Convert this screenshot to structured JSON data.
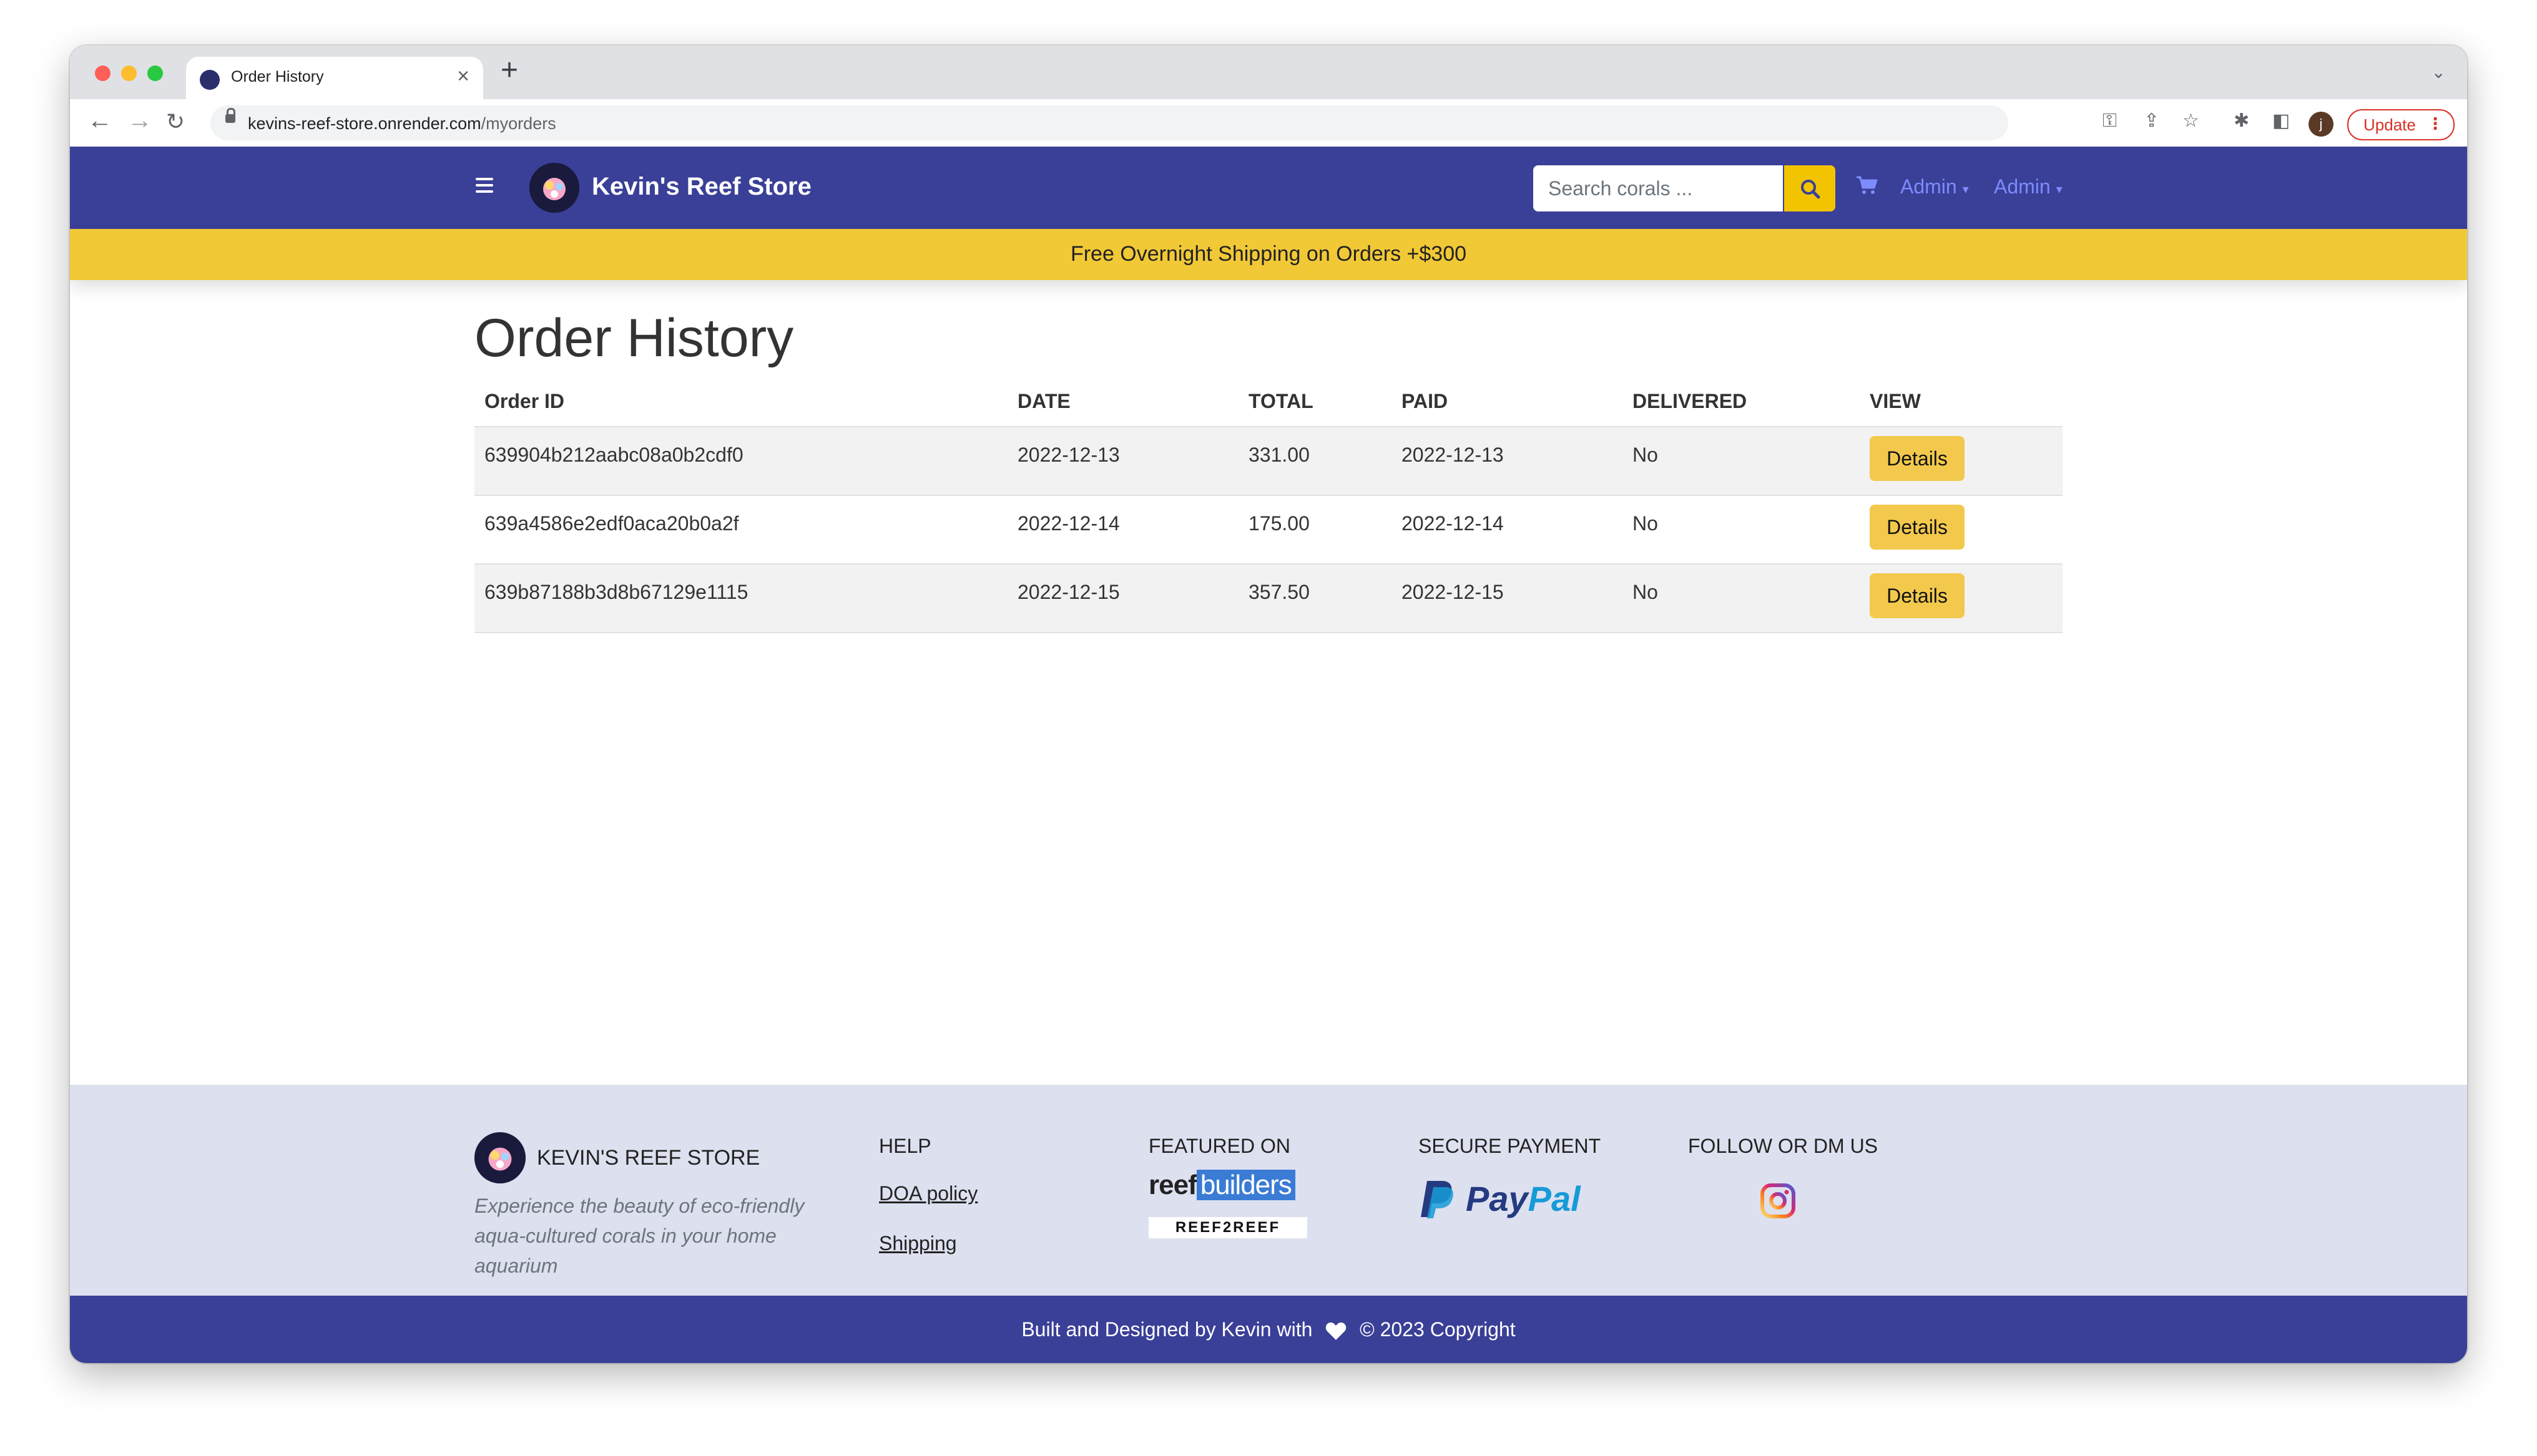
{
  "browser": {
    "tab_title": "Order History",
    "url_host": "kevins-reef-store.onrender.com",
    "url_path": "/myorders",
    "profile_initial": "j",
    "update_label": "Update"
  },
  "navbar": {
    "brand": "Kevin's Reef Store",
    "search_placeholder": "Search corals ...",
    "admin_menu_1": "Admin",
    "admin_menu_2": "Admin"
  },
  "banner": "Free Overnight Shipping on Orders +$300",
  "page_title": "Order History",
  "orders": {
    "columns": [
      "Order ID",
      "DATE",
      "TOTAL",
      "PAID",
      "DELIVERED",
      "VIEW"
    ],
    "rows": [
      {
        "id": "639904b212aabc08a0b2cdf0",
        "date": "2022-12-13",
        "total": "331.00",
        "paid": "2022-12-13",
        "delivered": "No",
        "action": "Details"
      },
      {
        "id": "639a4586e2edf0aca20b0a2f",
        "date": "2022-12-14",
        "total": "175.00",
        "paid": "2022-12-14",
        "delivered": "No",
        "action": "Details"
      },
      {
        "id": "639b87188b3d8b67129e1115",
        "date": "2022-12-15",
        "total": "357.50",
        "paid": "2022-12-15",
        "delivered": "No",
        "action": "Details"
      }
    ]
  },
  "footer": {
    "brand": "KEVIN'S REEF STORE",
    "description": "Experience the beauty of eco-friendly aqua-cultured corals in your home aquarium",
    "help_heading": "HELP",
    "help_links": [
      "DOA policy",
      "Shipping"
    ],
    "featured_heading": "FEATURED ON",
    "featured_1a": "reef",
    "featured_1b": "builders",
    "featured_2": "REEF2REEF",
    "payment_heading": "SECURE PAYMENT",
    "paypal_a": "Pay",
    "paypal_b": "Pal",
    "follow_heading": "FOLLOW OR DM US",
    "copyright_before": "Built and Designed by Kevin with",
    "copyright_after": "© 2023 Copyright"
  },
  "colors": {
    "navbar": "#3a3f97",
    "banner": "#f1c836",
    "button": "#f2c94c",
    "footer": "#dde0ef"
  }
}
